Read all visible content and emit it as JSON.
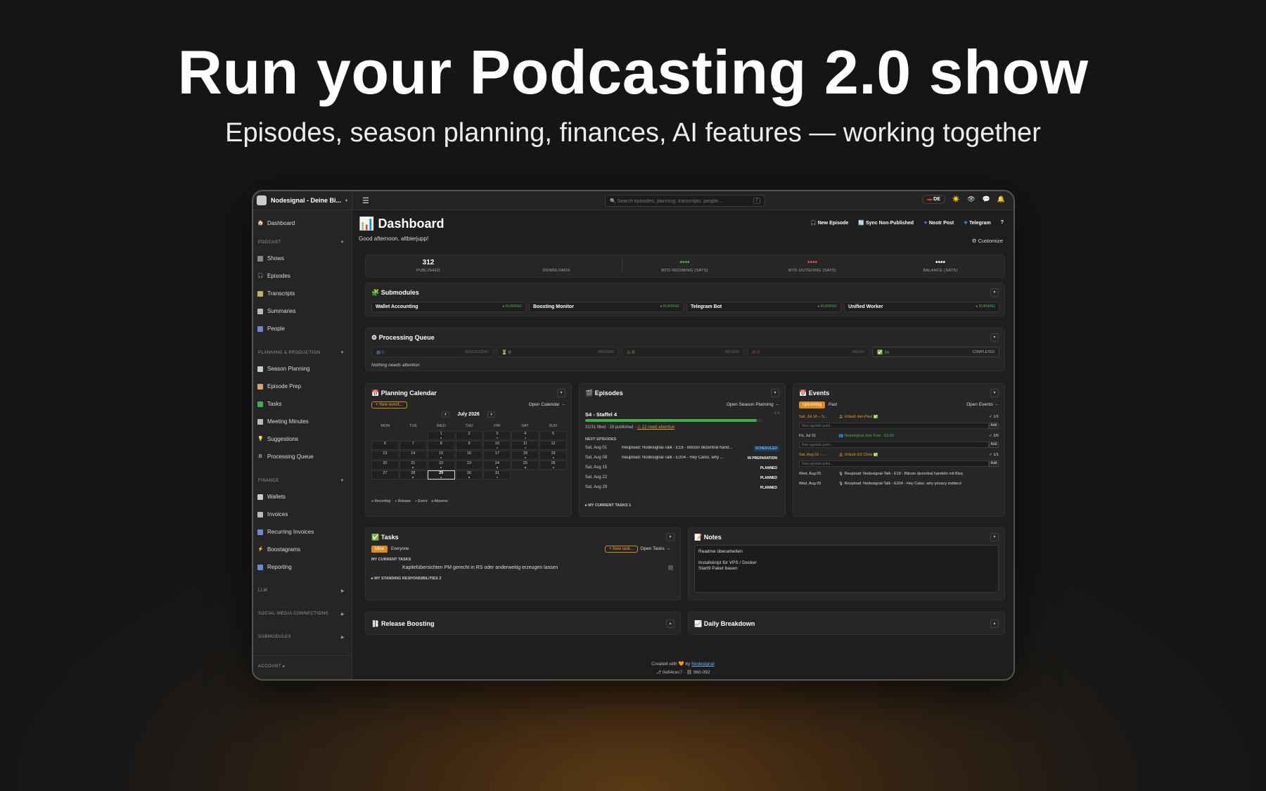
{
  "hero": {
    "title": "Run your Podcasting 2.0 show",
    "subtitle": "Episodes, season planning, finances, AI features — working together"
  },
  "topbar": {
    "brand": "Nodesignal - Deine Bi...",
    "search_placeholder": "Search episodes, planning, transcripts, people...",
    "shortcut": "/",
    "lang": "DE"
  },
  "sidebar": {
    "dashboard": "Dashboard",
    "podcast_section": "PODCAST",
    "podcast_items": [
      "Shows",
      "Episodes",
      "Transcripts",
      "Summaries",
      "People"
    ],
    "planning_section": "PLANNING & PRODUCTION",
    "planning_items": [
      "Season Planning",
      "Episode Prep",
      "Tasks",
      "Meeting Minutes",
      "Suggestions",
      "Processing Queue"
    ],
    "finance_section": "FINANCE",
    "finance_items": [
      "Wallets",
      "Invoices",
      "Recurring Invoices",
      "Boostagrams",
      "Reporting"
    ],
    "llm": "LLM",
    "social": "SOCIAL MEDIA CONNECTIONS",
    "submodules": "SUBMODULES",
    "account": "ACCOUNT"
  },
  "header": {
    "title": "Dashboard",
    "greeting": "Good afternoon, altbierjupp!",
    "actions": [
      "New Episode",
      "Sync Non-Published",
      "Nostr Post",
      "Telegram",
      "?"
    ],
    "customize": "Customize"
  },
  "stats": [
    {
      "value": "312",
      "label": "PUBLISHED",
      "color": "#ffffff"
    },
    {
      "value": "",
      "label": "DOWNLOADS",
      "color": "#ffffff"
    },
    {
      "value": "••••",
      "label": "MTD INCOMING (SATS)",
      "color": "#4caf50"
    },
    {
      "value": "••••",
      "label": "MTD OUTGOING (SATS)",
      "color": "#e05050"
    },
    {
      "value": "••••",
      "label": "BALANCE (SATS)",
      "color": "#ffffff"
    }
  ],
  "submodules": {
    "title": "Submodules",
    "items": [
      {
        "name": "Wallet Accounting",
        "status": "● RUNNING"
      },
      {
        "name": "Boosting Monitor",
        "status": "● RUNNING"
      },
      {
        "name": "Telegram Bot",
        "status": "● RUNNING"
      },
      {
        "name": "Unified Worker",
        "status": "● RUNNING"
      }
    ]
  },
  "queue": {
    "title": "Processing Queue",
    "items": [
      {
        "count": "0",
        "label": "PROCESSING"
      },
      {
        "count": "0",
        "label": "PENDING"
      },
      {
        "count": "0",
        "label": "REVIEW"
      },
      {
        "count": "0",
        "label": "FAILED"
      },
      {
        "count": "34",
        "label": "COMPLETED"
      }
    ],
    "empty": "Nothing needs attention"
  },
  "calendar": {
    "title": "Planning Calendar",
    "new_event": "+ New event...",
    "open": "Open Calendar →",
    "month": "July 2026",
    "weekdays": [
      "MON",
      "TUE",
      "WED",
      "THU",
      "FRI",
      "SAT",
      "SUN"
    ],
    "days": [
      "",
      "",
      "1",
      "2",
      "3",
      "4",
      "5",
      "6",
      "7",
      "8",
      "9",
      "10",
      "11",
      "12",
      "13",
      "14",
      "15",
      "16",
      "17",
      "18",
      "19",
      "20",
      "21",
      "22",
      "23",
      "24",
      "25",
      "26",
      "27",
      "28",
      "29",
      "30",
      "31"
    ],
    "today": "29",
    "legend": [
      "Recording",
      "Release",
      "Event",
      "Absence"
    ]
  },
  "episodes": {
    "title": "Episodes",
    "open": "Open Season Planning →",
    "season": "S4 - Staffel 4",
    "progress": 0.97,
    "filled": "31/31 filled · 28 published ·",
    "attention": "⚠ 12 need attention",
    "next_label": "NEXT EPISODES",
    "rows": [
      {
        "date": "Sat, Aug 01",
        "title": "Reupload: Nodesignal-Talk - E18 - Bitcoin dezentral hand...",
        "status": "SCHEDULED"
      },
      {
        "date": "Sat, Aug 08",
        "title": "Reupload: Nodesignal-Talk - E204 - Hey Calso, why ...",
        "status": "IN PREPARATION"
      },
      {
        "date": "Sat, Aug 15",
        "title": "",
        "status": "PLANNED"
      },
      {
        "date": "Sat, Aug 22",
        "title": "",
        "status": "PLANNED"
      },
      {
        "date": "Sat, Aug 29",
        "title": "",
        "status": "PLANNED"
      }
    ],
    "my_tasks": "▸ MY CURRENT TASKS   1"
  },
  "events": {
    "title": "Events",
    "tabs": [
      "Upcoming",
      "Past"
    ],
    "open": "Open Events →",
    "agenda_placeholder": "New agenda point...",
    "add": "Add",
    "rows": [
      {
        "date": "Sat, Jul 18 – S...",
        "title": "🏝 Urlaub Jan-Paul ✅",
        "meta": "✓ 1/1"
      },
      {
        "date": "Fri, Jul 31",
        "title": "👥 Nodesignal Jour Fixe · 13:00",
        "meta": "✓ 2/6"
      },
      {
        "date": "Sat, Aug 01 – ...",
        "title": "🏝 Urlaub 2/2 Chris ✅",
        "meta": "✓ 1/1"
      },
      {
        "date": "Wed, Aug 05",
        "title": "🎙 Reupload: Nodesignal-Talk - E18 - Bitcoin dezentral handeln mit Bisq",
        "meta": ""
      },
      {
        "date": "Wed, Aug 05",
        "title": "🎙 Reupload: Nodesignal-Talk - E204 - Hey Calso, why privacy matters!",
        "meta": ""
      }
    ]
  },
  "tasks": {
    "title": "Tasks",
    "tabs": [
      "Mine",
      "Everyone"
    ],
    "new": "+ New task...",
    "open": "Open Tasks →",
    "current_label": "MY CURRENT TASKS",
    "task": "Kapitelübersichten PM gerecht in RS oder anderweitig erzeugen lassen",
    "standing": "▸ MY STANDING RESPONSIBILITIES   2"
  },
  "notes": {
    "title": "Notes",
    "lines": [
      "Readme überarbeiten",
      "",
      "Installskript für VPS / Docker",
      "Start9 Paket bauen"
    ]
  },
  "release_boosting": {
    "title": "Release Boosting"
  },
  "daily_breakdown": {
    "title": "Daily Breakdown"
  },
  "footer": {
    "created": "Created with 🧡 by",
    "link": "Nodesignal",
    "version": "⎇ 0e64cec7 · ⛓ 960.092"
  }
}
